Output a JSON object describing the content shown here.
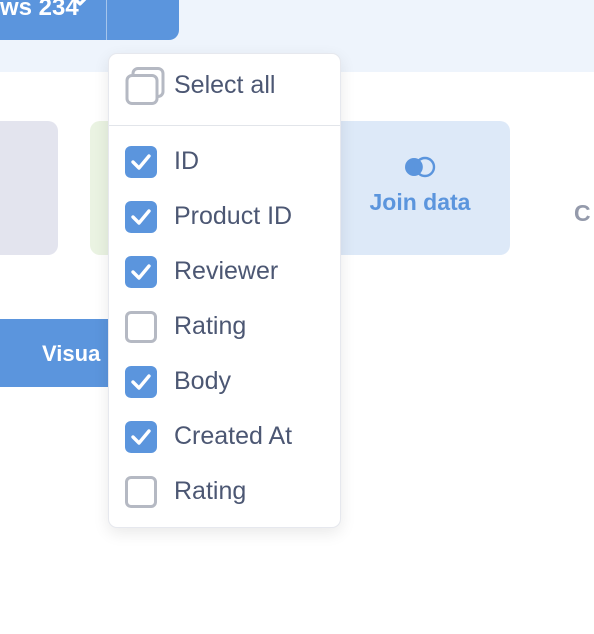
{
  "header": {
    "rows_button_label": "ws 234"
  },
  "steps": {
    "join_label": "Join data",
    "next_partial": "C"
  },
  "visualize_button_label": "Visua",
  "column_picker": {
    "select_all_label": "Select all",
    "options": [
      {
        "label": "ID",
        "checked": true
      },
      {
        "label": "Product ID",
        "checked": true
      },
      {
        "label": "Reviewer",
        "checked": true
      },
      {
        "label": "Rating",
        "checked": false
      },
      {
        "label": "Body",
        "checked": true
      },
      {
        "label": "Created At",
        "checked": true
      },
      {
        "label": "Rating",
        "checked": false
      }
    ]
  },
  "colors": {
    "brand": "#5b95dd",
    "text": "#4c5773",
    "header_bg": "#eef4fc",
    "join_card_bg": "#dde9f8"
  },
  "icons": {
    "select_all": "stacked-checkbox-icon",
    "join": "venn-join-icon",
    "dropdown": "chevron-down-icon",
    "checked": "checkmark-icon"
  }
}
